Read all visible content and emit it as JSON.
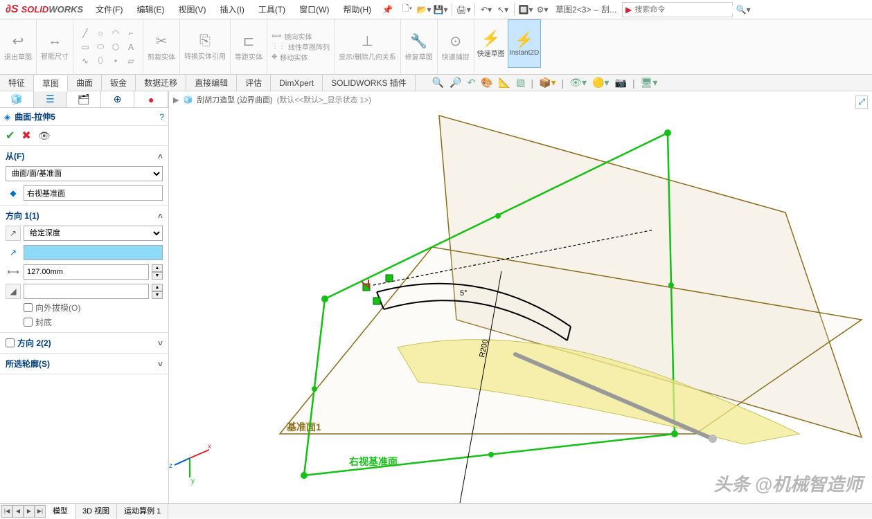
{
  "app": {
    "logo1": "SOLID",
    "logo2": "WORKS"
  },
  "menu": {
    "file": "文件(F)",
    "edit": "编辑(E)",
    "view": "视图(V)",
    "insert": "插入(I)",
    "tools": "工具(T)",
    "window": "窗口(W)",
    "help": "帮助(H)"
  },
  "breadcrumb_top": {
    "sketch": "草图2<3>",
    "sep": "–",
    "item": "刮..."
  },
  "search": {
    "placeholder": "搜索命令"
  },
  "ribbon": {
    "exit_sketch": "退出草图",
    "smart_dim": "智能尺寸",
    "trim": "剪裁实体",
    "convert": "转换实体引用",
    "offset": "等距实体",
    "mirror": "镜向实体",
    "linear_pattern": "线性草图阵列",
    "move": "移动实体",
    "display_del": "显示/删除几何关系",
    "repair": "修复草图",
    "quick_snap": "快速捕捉",
    "rapid_sketch": "快速草图",
    "instant2d": "Instant2D"
  },
  "tabs": {
    "feature": "特征",
    "sketch": "草图",
    "surface": "曲面",
    "sheetmetal": "钣金",
    "migrate": "数据迁移",
    "direct": "直接编辑",
    "eval": "评估",
    "dimxpert": "DimXpert",
    "addins": "SOLIDWORKS 插件"
  },
  "tree": {
    "part": "刮胡刀造型  (边界曲面)",
    "state": "(默认<<默认>_显示状态 1>)"
  },
  "fm": {
    "title": "曲面-拉伸5",
    "from_label": "从(F)",
    "from_option": "曲面/面/基准面",
    "from_selection": "右视基准面",
    "dir1_label": "方向 1(1)",
    "dir1_option": "给定深度",
    "dir1_value": "",
    "dir1_depth": "127.00mm",
    "draft_out": "向外拔模(O)",
    "cap": "封底",
    "dir2_label": "方向 2(2)",
    "contours_label": "所选轮廓(S)"
  },
  "viewport": {
    "plane1": "基准面1",
    "right_plane": "右视基准面",
    "dim_angle": "5°",
    "dim_radius": "R200"
  },
  "bottom": {
    "model": "模型",
    "view3d": "3D 视图",
    "motion": "运动算例 1"
  },
  "watermark": "头条 @机械智造师"
}
